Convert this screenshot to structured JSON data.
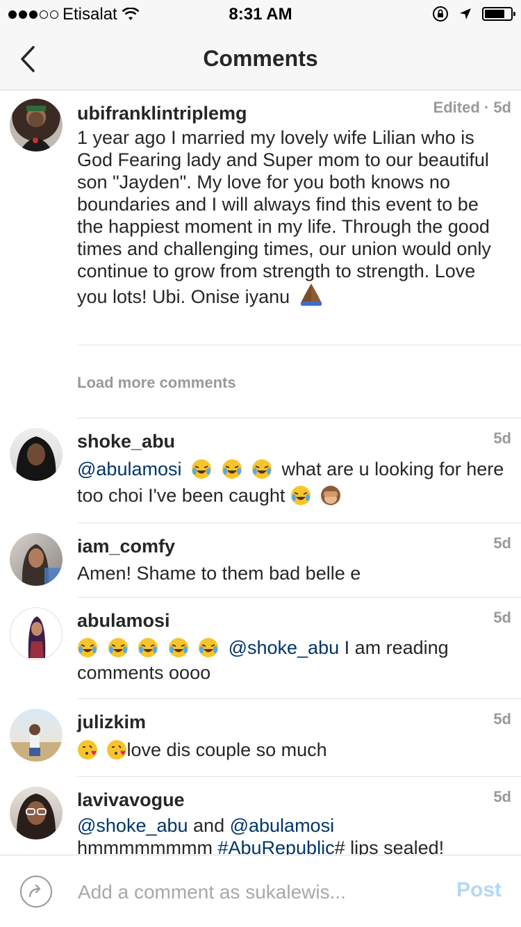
{
  "status_bar": {
    "carrier": "Etisalat",
    "time": "8:31 AM",
    "signal_bars_filled": 3,
    "signal_bars_total": 5,
    "battery_level": 0.8
  },
  "nav": {
    "title": "Comments",
    "back_icon": "chevron-left-icon"
  },
  "caption": {
    "username": "ubifranklintriplemg",
    "time": "Edited · 5d",
    "text": "1 year ago I married my lovely wife Lilian who is God Fearing lady and Super mom to our beautiful son \"Jayden\". My love for you both knows no boundaries and I will always find this event to be the happiest moment in my life. Through the good times and challenging times, our union would only continue to grow from strength to strength. Love you lots! Ubi. Onise iyanu",
    "emoji": "folded-hands-emoji"
  },
  "load_more": "Load more comments",
  "comments": [
    {
      "username": "shoke_abu",
      "time": "5d",
      "mention": "@abulamosi",
      "text": " what are u looking for here too choi I've been caught "
    },
    {
      "username": "iam_comfy",
      "time": "5d",
      "text": "Amen! Shame to them bad belle e"
    },
    {
      "username": "abulamosi",
      "time": "5d",
      "mention": "@shoke_abu",
      "text": " I am reading comments oooo"
    },
    {
      "username": "julizkim",
      "time": "5d",
      "text": "love dis couple so much"
    },
    {
      "username": "lavivavogue",
      "time": "5d",
      "mention1": "@shoke_abu",
      "and_text": " and ",
      "mention2": "@abulamosi",
      "pre_hashtag": "hmmmmmmmm ",
      "hashtag": "#AbuRepublic",
      "post_hashtag": "# lips sealed!"
    }
  ],
  "compose": {
    "placeholder": "Add a comment as sukalewis...",
    "value": "",
    "post_label": "Post"
  },
  "colors": {
    "mention": "#003569",
    "post_disabled": "#b3d8f5",
    "muted": "#999999"
  }
}
